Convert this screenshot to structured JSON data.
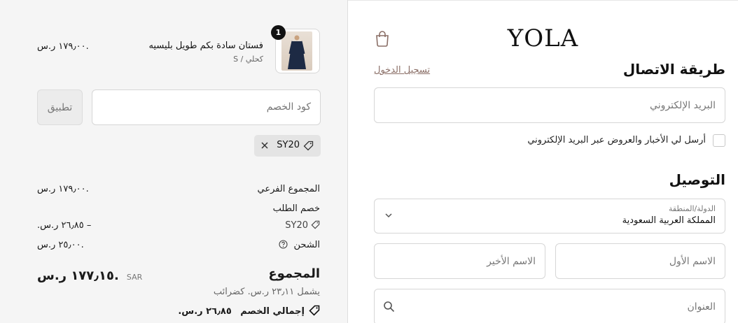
{
  "brand": {
    "logo_text": "YOLA"
  },
  "contact": {
    "title": "طريقة الاتصال",
    "login_link": "تسجيل الدخول",
    "email_placeholder": "البريد الإلكتروني",
    "newsletter_label": "أرسل لي الأخبار والعروض عبر البريد الإلكتروني",
    "newsletter_checked": false
  },
  "delivery": {
    "title": "التوصيل",
    "country_label": "الدولة/المنطقة",
    "country_value": "المملكة العربية السعودية",
    "first_name_placeholder": "الاسم الأول",
    "last_name_placeholder": "الاسم الأخير",
    "address_placeholder": "العنوان"
  },
  "summary": {
    "item": {
      "name": "فستان سادة بكم طويل بليسيه",
      "variant": "كحلي / S",
      "quantity": "1",
      "price": "١٧٩٫٠٠ ر.س."
    },
    "discount_placeholder": "كود الخصم",
    "apply_label": "تطبيق",
    "applied_code": "SY20",
    "subtotal_label": "المجموع الفرعي",
    "subtotal_value": "١٧٩٫٠٠ ر.س.",
    "order_discount_label": "خصم الطلب",
    "order_discount_code": "SY20",
    "order_discount_value": "– ٢٦٫٨٥ ر.س.",
    "shipping_label": "الشحن",
    "shipping_value": "٢٥٫٠٠ ر.س.",
    "total_label": "المجموع",
    "currency_code": "SAR",
    "total_value": "١٧٧٫١٥ ر.س.",
    "tax_note": "يشمل ٢٣٫١١ ر.س. كضرائب",
    "total_savings_label": "إجمالي الخصم",
    "total_savings_value": "٢٦٫٨٥ ر.س."
  },
  "colors": {
    "accent_link": "#8a6e66",
    "summary_bg": "#f5f5f5",
    "badge": "#111111"
  },
  "icons": [
    "shopping-bag-icon",
    "chevron-down-icon",
    "search-icon",
    "tag-icon",
    "close-icon",
    "help-circle-icon",
    "savings-tag-icon"
  ]
}
